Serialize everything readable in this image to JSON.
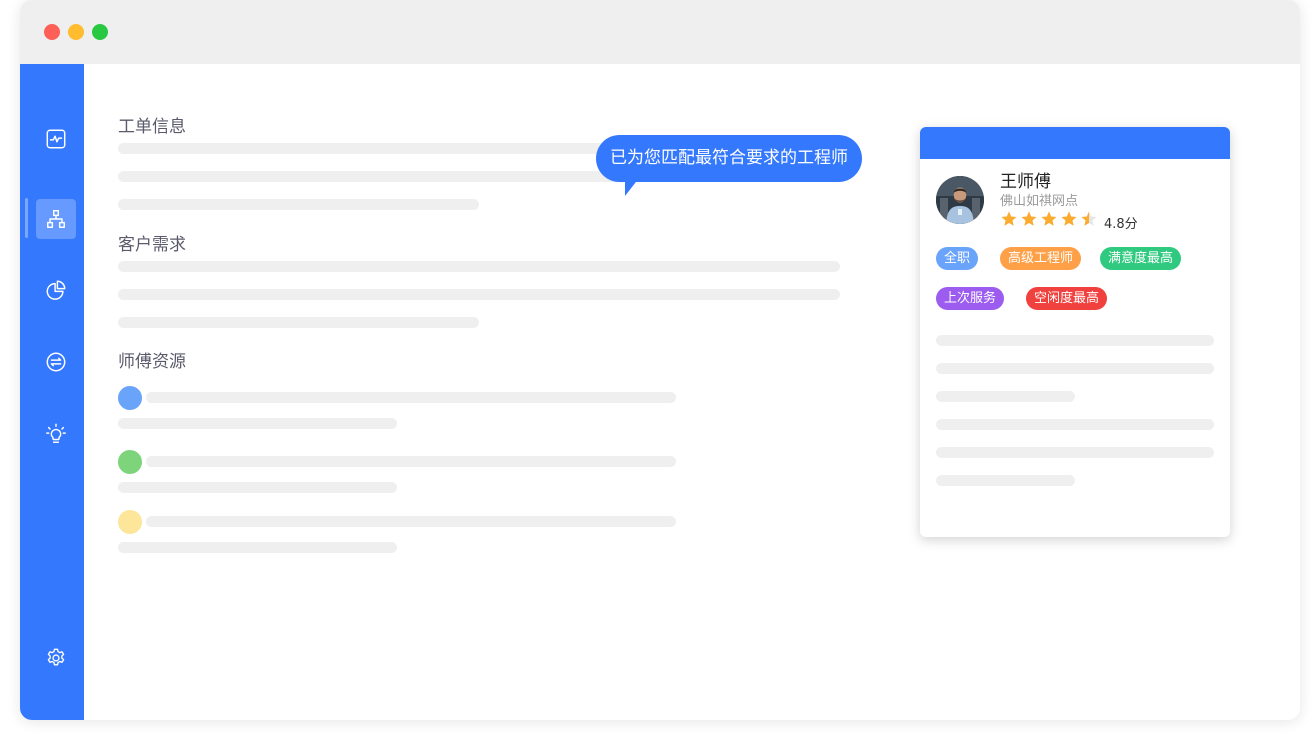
{
  "sections": {
    "order_info": "工单信息",
    "customer_needs": "客户需求",
    "master_resources": "师傅资源"
  },
  "bubble": {
    "text": "已为您匹配最符合要求的工程师"
  },
  "sidebar": {
    "items": [
      {
        "icon": "monitor-icon"
      },
      {
        "icon": "org-chart-icon",
        "active": true
      },
      {
        "icon": "pie-chart-icon"
      },
      {
        "icon": "exchange-icon"
      },
      {
        "icon": "lightbulb-icon"
      }
    ],
    "settings_icon": "gear-icon"
  },
  "resources": [
    {
      "color": "#6aa3fa"
    },
    {
      "color": "#7dd47a"
    },
    {
      "color": "#fde69a"
    }
  ],
  "card": {
    "name": "王师傅",
    "location": "佛山如祺网点",
    "rating_value": 4.5,
    "rating": "4.8分",
    "tags": [
      {
        "label": "全职",
        "color": "#6aa3fa"
      },
      {
        "label": "高级工程师",
        "color": "#fda047"
      },
      {
        "label": "满意度最高",
        "color": "#2fc97f"
      },
      {
        "label": "上次服务",
        "color": "#9b5cef"
      },
      {
        "label": "空闲度最高",
        "color": "#f0413e"
      }
    ]
  },
  "colors": {
    "accent": "#3478fe",
    "skeleton": "#efefef",
    "star": "#fbac2f"
  }
}
